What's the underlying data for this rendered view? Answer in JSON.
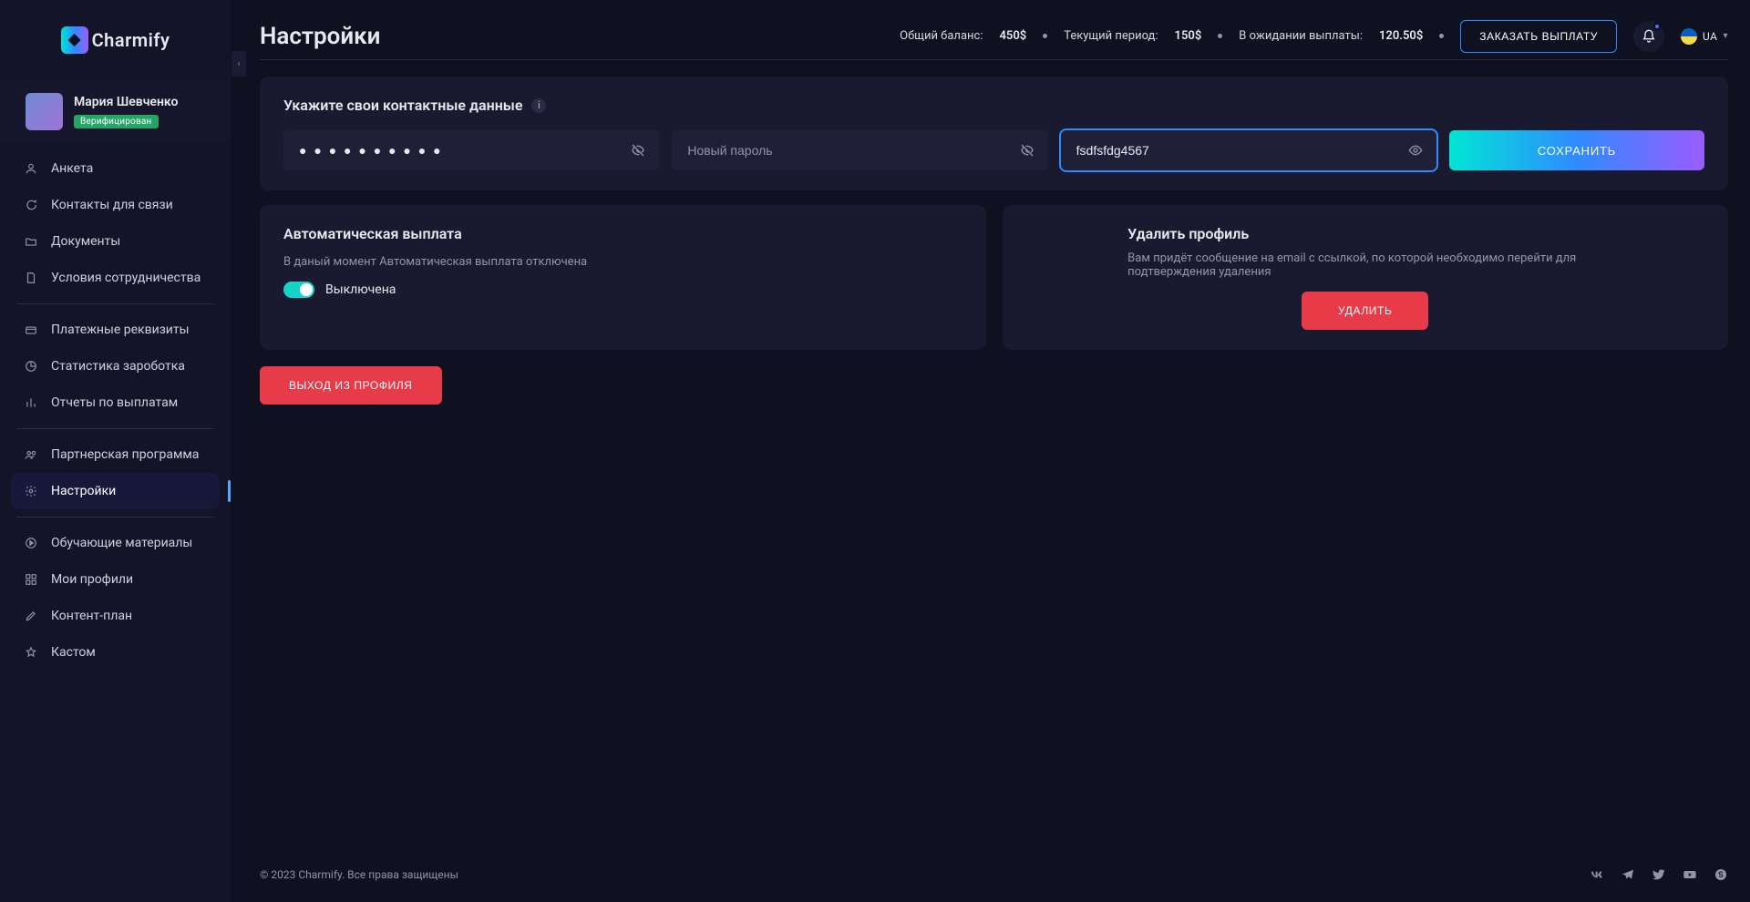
{
  "brand": {
    "name": "Charmify"
  },
  "topbar": {
    "title": "Настройки",
    "total_balance_label": "Общий баланс:",
    "total_balance_value": "450$",
    "current_period_label": "Текущий период:",
    "current_period_value": "150$",
    "pending_label": "В ожидании выплаты:",
    "pending_value": "120.50$",
    "order_payout_btn": "ЗАКАЗАТЬ ВЫПЛАТУ",
    "lang": "UA"
  },
  "user": {
    "name": "Мария Шевченко",
    "verified_label": "Верифицирован"
  },
  "sidebar": {
    "items": [
      {
        "icon": "user",
        "label": "Анкета"
      },
      {
        "icon": "chat",
        "label": "Контакты для связи"
      },
      {
        "icon": "folder",
        "label": "Документы"
      },
      {
        "icon": "doc",
        "label": "Условия сотрудничества"
      }
    ],
    "items2": [
      {
        "icon": "wallet",
        "label": "Платежные реквизиты"
      },
      {
        "icon": "pie",
        "label": "Статистика зароботка"
      },
      {
        "icon": "bars",
        "label": "Отчеты по выплатам"
      }
    ],
    "items3": [
      {
        "icon": "users",
        "label": "Партнерская программа"
      },
      {
        "icon": "gear",
        "label": "Настройки"
      }
    ],
    "items4": [
      {
        "icon": "play",
        "label": "Обучающие материалы"
      },
      {
        "icon": "grid",
        "label": "Мои профили"
      },
      {
        "icon": "pencil",
        "label": "Контент-план"
      },
      {
        "icon": "star",
        "label": "Кастом"
      }
    ]
  },
  "contact_card": {
    "title": "Укажите свои контактные данные",
    "password_value": "● ● ● ● ● ● ● ● ● ●",
    "new_password_placeholder": "Новый пароль",
    "text_input_value": "fsdfsfdg4567",
    "save_btn": "СОХРАНИТЬ"
  },
  "auto_payout": {
    "title": "Автоматическая выплата",
    "desc": "В даный момент Автоматическая выплата отключена",
    "state_label": "Выключена"
  },
  "delete_profile": {
    "title": "Удалить профиль",
    "desc": "Вам придёт сообщение на email с ссылкой, по которой необходимо перейти для подтверждения удаления",
    "btn": "УДАЛИТЬ"
  },
  "logout_btn": "ВЫХОД ИЗ ПРОФИЛЯ",
  "footer": {
    "copyright": "© 2023 Charmify. Все права защищены"
  }
}
